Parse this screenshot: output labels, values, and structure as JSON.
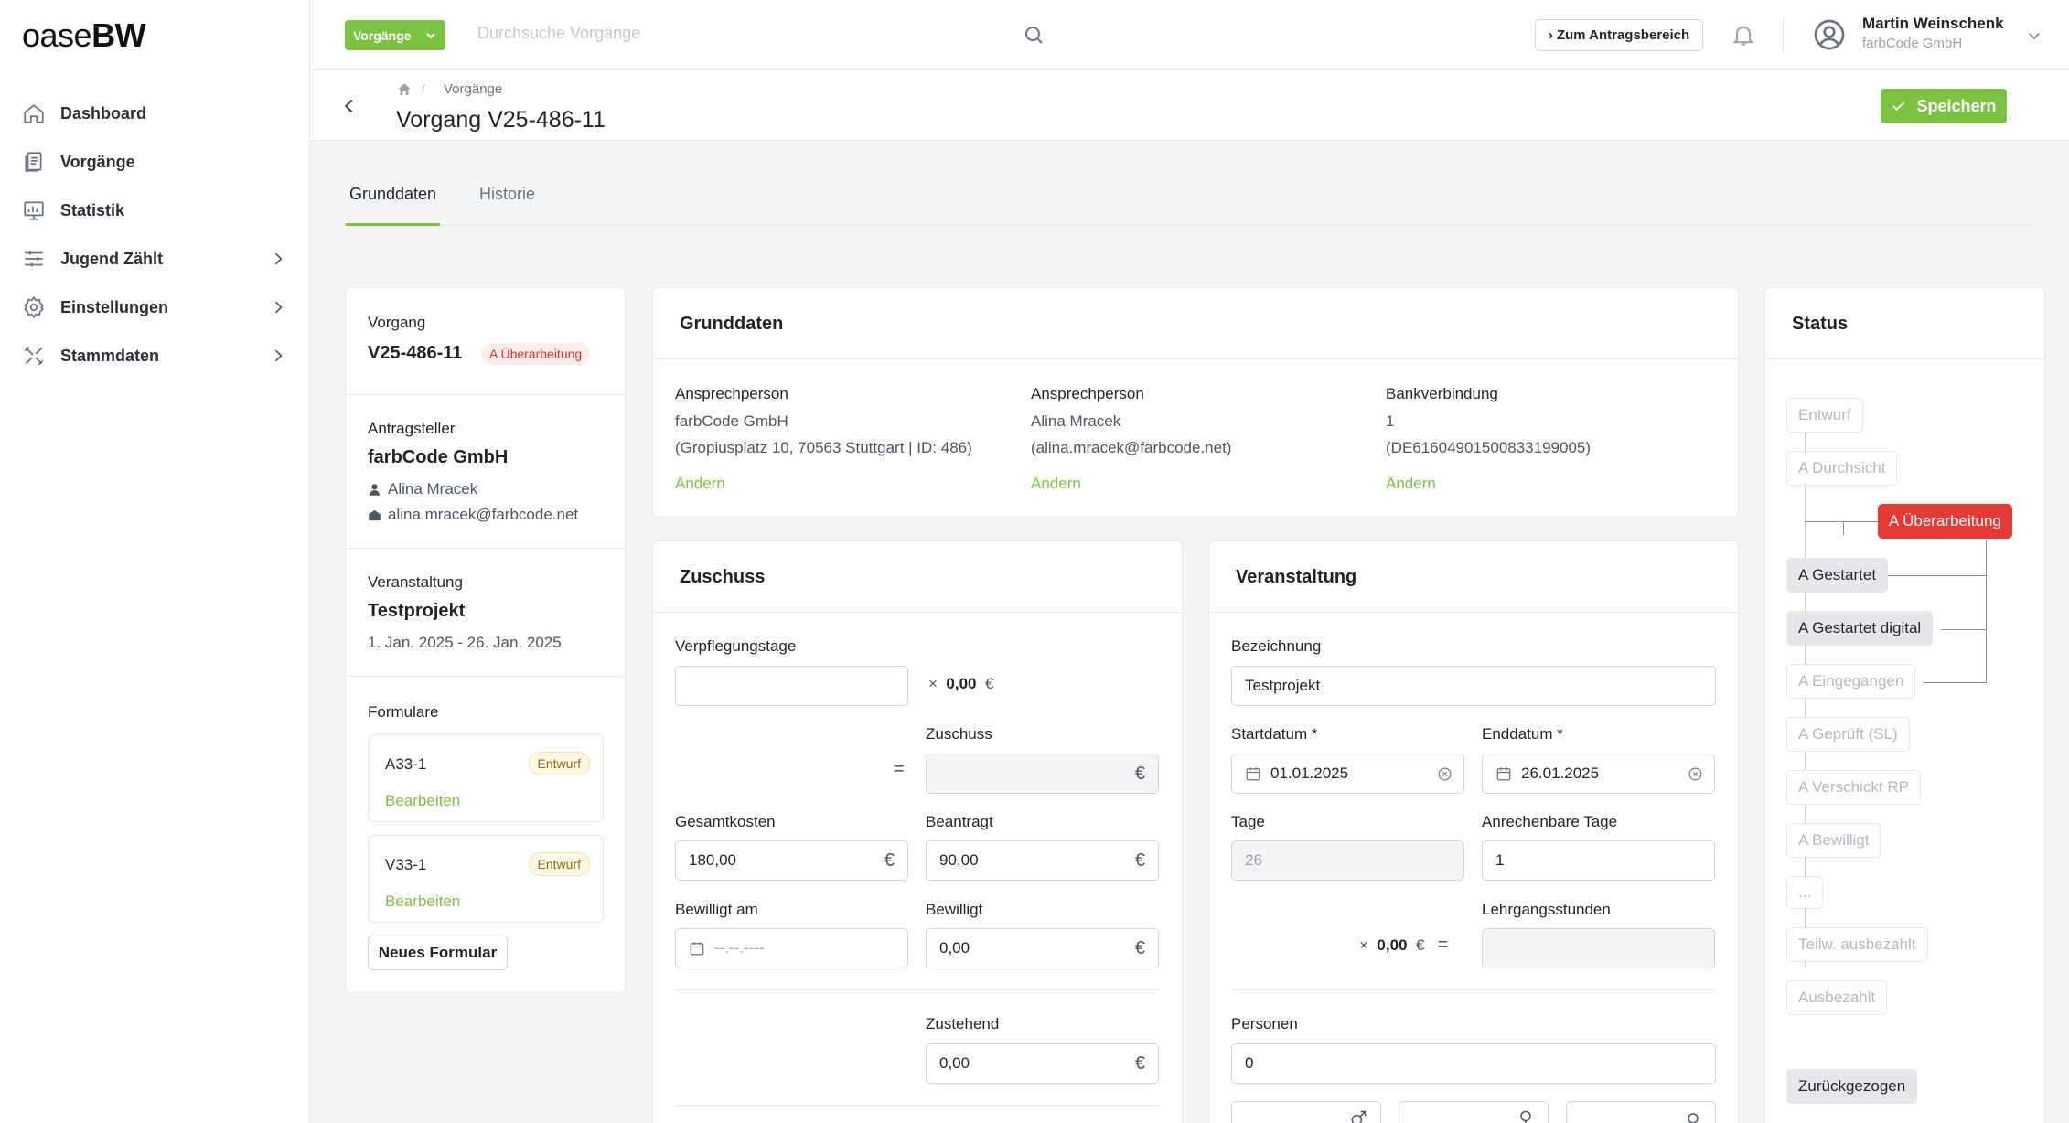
{
  "brand": {
    "prefix": "oase",
    "suffix": "BW"
  },
  "sidebar": {
    "items": [
      {
        "label": "Dashboard",
        "icon": "home-icon"
      },
      {
        "label": "Vorgänge",
        "icon": "documents-icon"
      },
      {
        "label": "Statistik",
        "icon": "chart-icon"
      },
      {
        "label": "Jugend Zählt",
        "icon": "sliders-icon"
      },
      {
        "label": "Einstellungen",
        "icon": "gear-icon"
      },
      {
        "label": "Stammdaten",
        "icon": "tools-icon"
      }
    ]
  },
  "topbar": {
    "select_label": "Vorgänge",
    "search_placeholder": "Durchsuche Vorgänge",
    "antrag_button": "Zum Antragsbereich",
    "user_name": "Martin Weinschenk",
    "user_company": "farbCode GmbH"
  },
  "subheader": {
    "breadcrumb": "Vorgänge",
    "title": "Vorgang V25-486-11",
    "save_label": "Speichern"
  },
  "tabs": [
    "Grunddaten",
    "Historie"
  ],
  "summary": {
    "vorgang_label": "Vorgang",
    "vorgang_id": "V25-486-11",
    "status_badge": "A Überarbeitung",
    "antragsteller_label": "Antragsteller",
    "antragsteller_name": "farbCode GmbH",
    "contact_name": "Alina Mracek",
    "contact_email": "alina.mracek@farbcode.net",
    "veranstaltung_label": "Veranstaltung",
    "veranstaltung_name": "Testprojekt",
    "veranstaltung_dates": "1. Jan. 2025 - 26. Jan. 2025",
    "formulare_label": "Formulare",
    "forms": [
      {
        "name": "A33-1",
        "status": "Entwurf",
        "action": "Bearbeiten"
      },
      {
        "name": "V33-1",
        "status": "Entwurf",
        "action": "Bearbeiten"
      }
    ],
    "new_form_button": "Neues Formular"
  },
  "grunddaten": {
    "title": "Grunddaten",
    "col1": {
      "label": "Ansprechperson",
      "line1": "farbCode GmbH",
      "line2": "(Gropiusplatz 10, 70563 Stuttgart | ID: 486)",
      "link": "Ändern"
    },
    "col2": {
      "label": "Ansprechperson",
      "line1": "Alina Mracek",
      "line2": "(alina.mracek@farbcode.net)",
      "link": "Ändern"
    },
    "col3": {
      "label": "Bankverbindung",
      "line1": "1",
      "line2": "(DE61604901500833199005)",
      "link": "Ändern"
    }
  },
  "zuschuss": {
    "title": "Zuschuss",
    "verpflegungstage_label": "Verpflegungstage",
    "verpflegungstage_value": "",
    "mult_sign": "×",
    "mult_value": "0,00",
    "currency": "€",
    "equals": "=",
    "zuschuss_label": "Zuschuss",
    "zuschuss_value": "",
    "gesamtkosten_label": "Gesamtkosten",
    "gesamtkosten_value": "180,00",
    "beantragt_label": "Beantragt",
    "beantragt_value": "90,00",
    "bewilligt_am_label": "Bewilligt am",
    "bewilligt_am_placeholder": "--.--.----",
    "bewilligt_label": "Bewilligt",
    "bewilligt_value": "0,00",
    "zustehend_label": "Zustehend",
    "zustehend_value": "0,00"
  },
  "veranstaltung": {
    "title": "Veranstaltung",
    "bezeichnung_label": "Bezeichnung",
    "bezeichnung_value": "Testprojekt",
    "startdatum_label": "Startdatum *",
    "startdatum_value": "01.01.2025",
    "enddatum_label": "Enddatum *",
    "enddatum_value": "26.01.2025",
    "tage_label": "Tage",
    "tage_value": "26",
    "anrechenbare_label": "Anrechenbare Tage",
    "anrechenbare_value": "1",
    "lehrgang_label": "Lehrgangsstunden",
    "lehrgang_value": "",
    "mult_sign": "×",
    "mult_value": "0,00",
    "currency": "€",
    "equals": "=",
    "personen_label": "Personen",
    "personen_value": "0"
  },
  "status": {
    "title": "Status",
    "items": [
      {
        "label": "Entwurf",
        "state": "faded"
      },
      {
        "label": "A Durchsicht",
        "state": "faded"
      },
      {
        "label": "A Überarbeitung",
        "state": "current"
      },
      {
        "label": "A Gestartet",
        "state": "active"
      },
      {
        "label": "A Gestartet digital",
        "state": "active"
      },
      {
        "label": "A Eingegangen",
        "state": "faded"
      },
      {
        "label": "A Geprüft (SL)",
        "state": "faded"
      },
      {
        "label": "A Verschickt RP",
        "state": "faded"
      },
      {
        "label": "A Bewilligt",
        "state": "faded"
      },
      {
        "label": "...",
        "state": "faded"
      },
      {
        "label": "Teilw. ausbezahlt",
        "state": "faded"
      },
      {
        "label": "Ausbezahlt",
        "state": "faded"
      },
      {
        "label": "Zurückgezogen",
        "state": "active"
      }
    ]
  },
  "colors": {
    "accent": "#7cc242",
    "danger": "#e53935",
    "badge_red_bg": "#fdecec",
    "badge_yellow_bg": "#fdf7e3"
  }
}
